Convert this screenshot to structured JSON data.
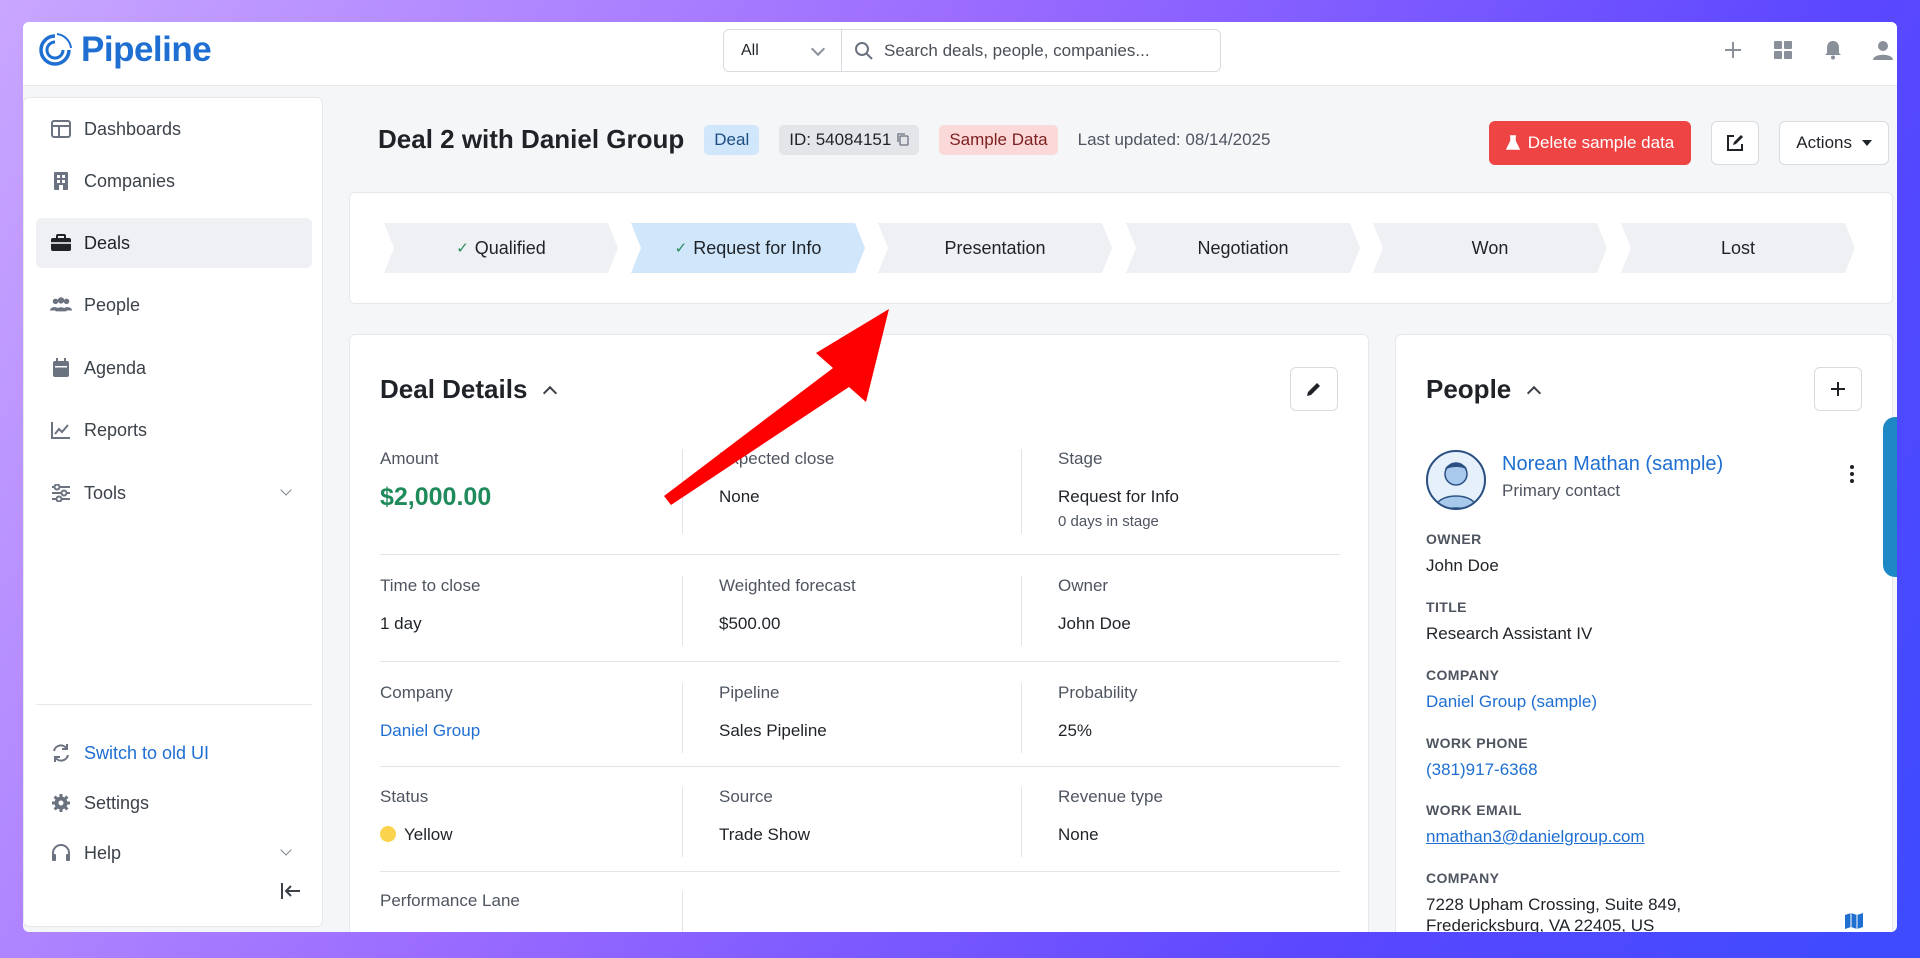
{
  "app": {
    "name": "Pipeline"
  },
  "search": {
    "filter": "All",
    "placeholder": "Search deals, people, companies..."
  },
  "sidebar": {
    "items": [
      {
        "label": "Dashboards",
        "icon": "dashboard-icon"
      },
      {
        "label": "Companies",
        "icon": "building-icon"
      },
      {
        "label": "Deals",
        "icon": "briefcase-icon",
        "active": true
      },
      {
        "label": "People",
        "icon": "people-icon"
      },
      {
        "label": "Agenda",
        "icon": "calendar-icon"
      },
      {
        "label": "Reports",
        "icon": "chart-line-icon"
      },
      {
        "label": "Tools",
        "icon": "sliders-icon"
      }
    ],
    "footer": [
      {
        "label": "Switch to old UI",
        "icon": "refresh-icon"
      },
      {
        "label": "Settings",
        "icon": "gear-icon"
      },
      {
        "label": "Help",
        "icon": "headset-icon"
      }
    ]
  },
  "deal": {
    "title": "Deal 2 with Daniel Group",
    "type_tag": "Deal",
    "id_tag": "ID: 54084151",
    "sample_tag": "Sample Data",
    "last_updated": "Last updated: 08/14/2025",
    "delete_label": "Delete sample data",
    "actions_label": "Actions"
  },
  "stages": [
    {
      "label": "Qualified",
      "status": "done"
    },
    {
      "label": "Request for Info",
      "status": "current"
    },
    {
      "label": "Presentation",
      "status": "todo"
    },
    {
      "label": "Negotiation",
      "status": "todo"
    },
    {
      "label": "Won",
      "status": "todo"
    },
    {
      "label": "Lost",
      "status": "todo"
    }
  ],
  "details": {
    "title": "Deal Details",
    "fields": {
      "amount": {
        "label": "Amount",
        "value": "$2,000.00"
      },
      "expected_close": {
        "label": "Expected close",
        "value": "None"
      },
      "stage": {
        "label": "Stage",
        "value": "Request for Info",
        "sub": "0 days in stage"
      },
      "time_to_close": {
        "label": "Time to close",
        "value": "1 day"
      },
      "weighted_forecast": {
        "label": "Weighted forecast",
        "value": "$500.00"
      },
      "owner": {
        "label": "Owner",
        "value": "John Doe"
      },
      "company": {
        "label": "Company",
        "value": "Daniel Group"
      },
      "pipeline": {
        "label": "Pipeline",
        "value": "Sales Pipeline"
      },
      "probability": {
        "label": "Probability",
        "value": "25%"
      },
      "status": {
        "label": "Status",
        "value": "Yellow"
      },
      "source": {
        "label": "Source",
        "value": "Trade Show"
      },
      "revenue_type": {
        "label": "Revenue type",
        "value": "None"
      },
      "performance_lane": {
        "label": "Performance Lane"
      }
    }
  },
  "people": {
    "title": "People",
    "contact": {
      "name": "Norean Mathan (sample)",
      "role": "Primary contact",
      "owner_label": "OWNER",
      "owner": "John Doe",
      "title_label": "TITLE",
      "title": "Research Assistant IV",
      "company_label": "COMPANY",
      "company": "Daniel Group (sample)",
      "phone_label": "WORK PHONE",
      "phone": "(381)917-6368",
      "email_label": "WORK EMAIL",
      "email": "nmathan3@danielgroup.com",
      "address_label": "COMPANY",
      "address_line1": "7228 Upham Crossing, Suite 849,",
      "address_line2": "Fredericksburg, VA 22405, US"
    }
  },
  "colors": {
    "brand": "#1e6fd1",
    "danger": "#ef4444",
    "amount": "#1f8a5a",
    "current_stage": "#cfe6fb",
    "annotation_arrow": "#ff0000"
  }
}
